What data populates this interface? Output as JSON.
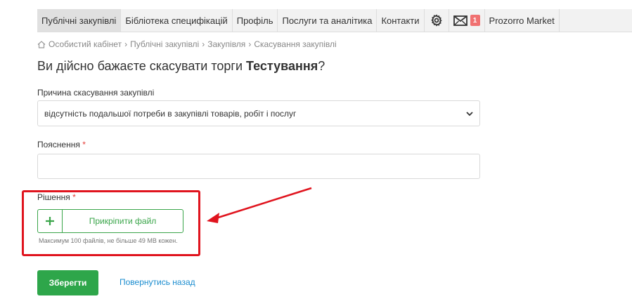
{
  "topnav": {
    "items": [
      {
        "label": "Публічні закупівлі",
        "active": true
      },
      {
        "label": "Бібліотека специфікацій"
      },
      {
        "label": "Профіль"
      },
      {
        "label": "Послуги та аналітика"
      },
      {
        "label": "Контакти"
      }
    ],
    "settings_icon": "gear-icon",
    "mail_icon": "envelope-icon",
    "mail_count": "1",
    "market_label": "Prozorro Market"
  },
  "breadcrumb": {
    "home_icon": "home-icon",
    "items": [
      "Особистий кабінет",
      "Публічні закупівлі",
      "Закупівля",
      "Скасування закупівлі"
    ],
    "separator": "›"
  },
  "title": {
    "prefix": "Ви дійсно бажаєте скасувати торги ",
    "name": "Тестування",
    "suffix": "?"
  },
  "form": {
    "reason_label": "Причина скасування закупівлі",
    "reason_value": "відсутність подальшої потреби в закупівлі товарів, робіт і послуг",
    "explanation_label": "Пояснення",
    "explanation_value": "",
    "required_mark": "*",
    "decision_label": "Рішення",
    "attach_icon": "plus-icon",
    "attach_label": "Прикріпити файл",
    "attach_hint": "Максимум 100 файлів, не більше 49 MB кожен."
  },
  "actions": {
    "save_label": "Зберегти",
    "back_label": "Повернутись назад"
  },
  "colors": {
    "accent_green": "#2ea64a",
    "link_blue": "#1a8ccf",
    "highlight_red": "#e0141e",
    "badge_red": "#f07070"
  }
}
